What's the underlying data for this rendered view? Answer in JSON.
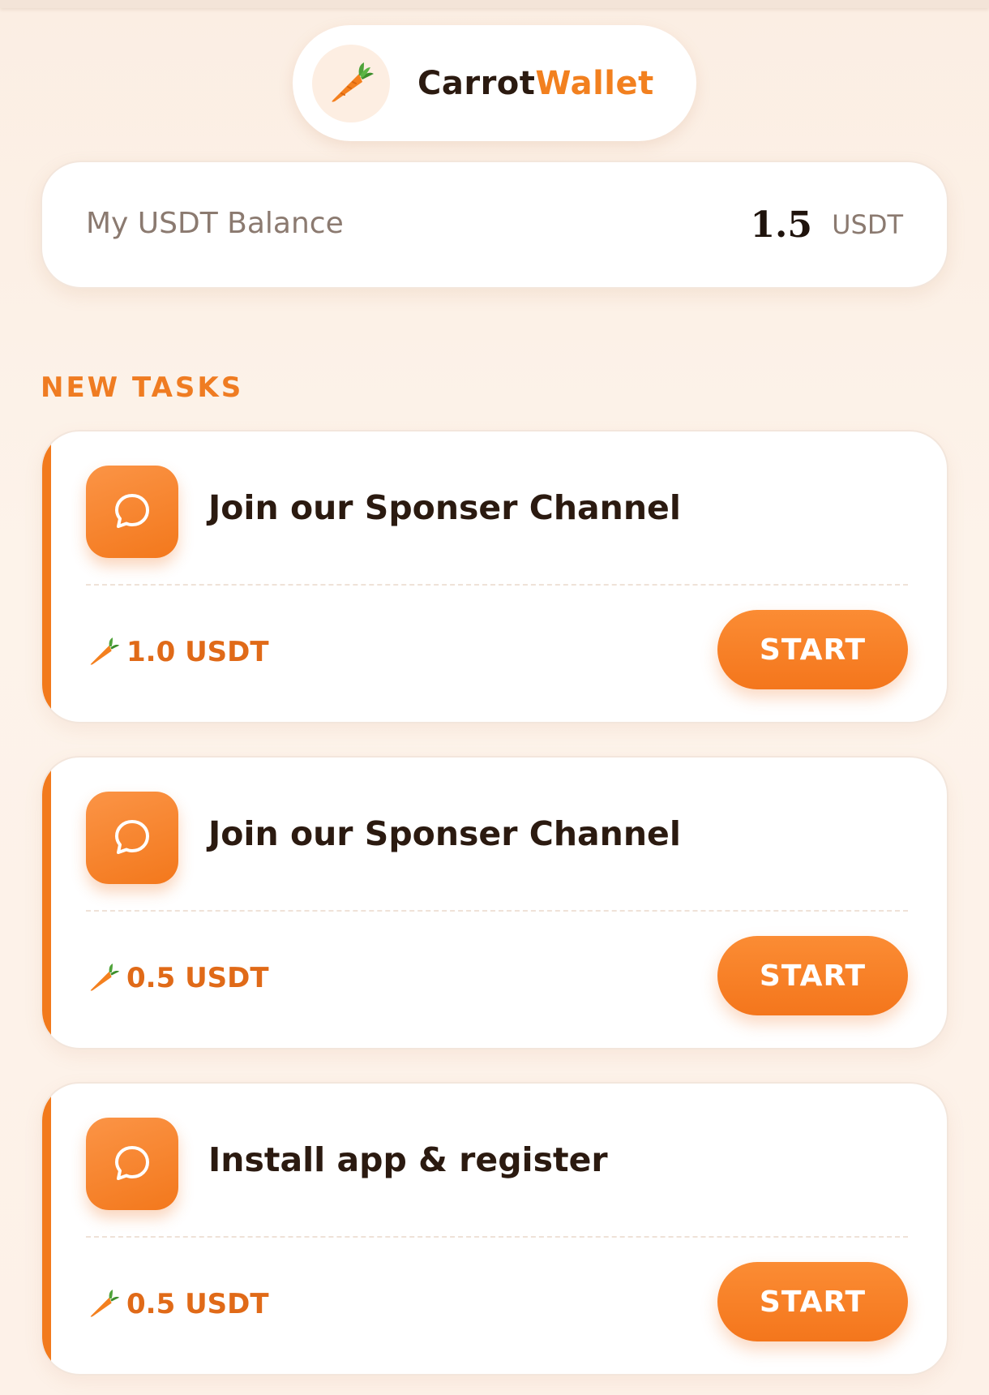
{
  "brand": {
    "name_part1": "Carrot",
    "name_part2": "Wallet",
    "logo_icon": "carrot-icon",
    "accent_color": "#f2801f"
  },
  "balance": {
    "label": "My USDT Balance",
    "amount": "1.5",
    "unit": "USDT"
  },
  "tasks_section": {
    "title": "NEW TASKS"
  },
  "tasks": [
    {
      "title": "Join our Sponser Channel",
      "reward": "1.0 USDT",
      "button_label": "START",
      "icon": "chat-bubble-icon"
    },
    {
      "title": "Join our Sponser Channel",
      "reward": "0.5 USDT",
      "button_label": "START",
      "icon": "chat-bubble-icon"
    },
    {
      "title": "Install app & register",
      "reward": "0.5 USDT",
      "button_label": "START",
      "icon": "chat-bubble-icon"
    }
  ],
  "colors": {
    "primary": "#f27a1c",
    "background": "#fdf1e8",
    "text_dark": "#2b1a10"
  }
}
